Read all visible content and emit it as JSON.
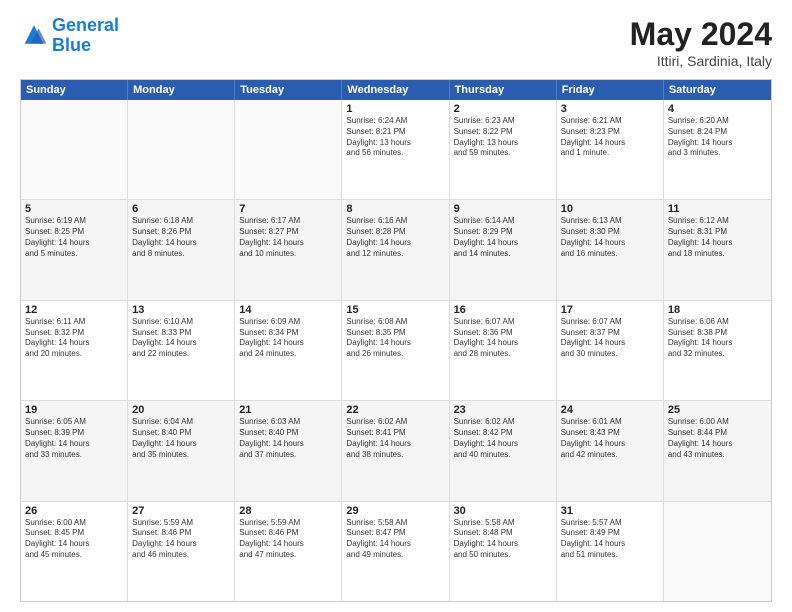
{
  "logo": {
    "text_general": "General",
    "text_blue": "Blue"
  },
  "header": {
    "title": "May 2024",
    "subtitle": "Ittiri, Sardinia, Italy"
  },
  "weekdays": [
    "Sunday",
    "Monday",
    "Tuesday",
    "Wednesday",
    "Thursday",
    "Friday",
    "Saturday"
  ],
  "rows": [
    [
      {
        "day": "",
        "empty": true,
        "lines": []
      },
      {
        "day": "",
        "empty": true,
        "lines": []
      },
      {
        "day": "",
        "empty": true,
        "lines": []
      },
      {
        "day": "1",
        "lines": [
          "Sunrise: 6:24 AM",
          "Sunset: 8:21 PM",
          "Daylight: 13 hours",
          "and 56 minutes."
        ]
      },
      {
        "day": "2",
        "lines": [
          "Sunrise: 6:23 AM",
          "Sunset: 8:22 PM",
          "Daylight: 13 hours",
          "and 59 minutes."
        ]
      },
      {
        "day": "3",
        "lines": [
          "Sunrise: 6:21 AM",
          "Sunset: 8:23 PM",
          "Daylight: 14 hours",
          "and 1 minute."
        ]
      },
      {
        "day": "4",
        "lines": [
          "Sunrise: 6:20 AM",
          "Sunset: 8:24 PM",
          "Daylight: 14 hours",
          "and 3 minutes."
        ]
      }
    ],
    [
      {
        "day": "5",
        "lines": [
          "Sunrise: 6:19 AM",
          "Sunset: 8:25 PM",
          "Daylight: 14 hours",
          "and 5 minutes."
        ]
      },
      {
        "day": "6",
        "lines": [
          "Sunrise: 6:18 AM",
          "Sunset: 8:26 PM",
          "Daylight: 14 hours",
          "and 8 minutes."
        ]
      },
      {
        "day": "7",
        "lines": [
          "Sunrise: 6:17 AM",
          "Sunset: 8:27 PM",
          "Daylight: 14 hours",
          "and 10 minutes."
        ]
      },
      {
        "day": "8",
        "lines": [
          "Sunrise: 6:16 AM",
          "Sunset: 8:28 PM",
          "Daylight: 14 hours",
          "and 12 minutes."
        ]
      },
      {
        "day": "9",
        "lines": [
          "Sunrise: 6:14 AM",
          "Sunset: 8:29 PM",
          "Daylight: 14 hours",
          "and 14 minutes."
        ]
      },
      {
        "day": "10",
        "lines": [
          "Sunrise: 6:13 AM",
          "Sunset: 8:30 PM",
          "Daylight: 14 hours",
          "and 16 minutes."
        ]
      },
      {
        "day": "11",
        "lines": [
          "Sunrise: 6:12 AM",
          "Sunset: 8:31 PM",
          "Daylight: 14 hours",
          "and 18 minutes."
        ]
      }
    ],
    [
      {
        "day": "12",
        "lines": [
          "Sunrise: 6:11 AM",
          "Sunset: 8:32 PM",
          "Daylight: 14 hours",
          "and 20 minutes."
        ]
      },
      {
        "day": "13",
        "lines": [
          "Sunrise: 6:10 AM",
          "Sunset: 8:33 PM",
          "Daylight: 14 hours",
          "and 22 minutes."
        ]
      },
      {
        "day": "14",
        "lines": [
          "Sunrise: 6:09 AM",
          "Sunset: 8:34 PM",
          "Daylight: 14 hours",
          "and 24 minutes."
        ]
      },
      {
        "day": "15",
        "lines": [
          "Sunrise: 6:08 AM",
          "Sunset: 8:35 PM",
          "Daylight: 14 hours",
          "and 26 minutes."
        ]
      },
      {
        "day": "16",
        "lines": [
          "Sunrise: 6:07 AM",
          "Sunset: 8:36 PM",
          "Daylight: 14 hours",
          "and 28 minutes."
        ]
      },
      {
        "day": "17",
        "lines": [
          "Sunrise: 6:07 AM",
          "Sunset: 8:37 PM",
          "Daylight: 14 hours",
          "and 30 minutes."
        ]
      },
      {
        "day": "18",
        "lines": [
          "Sunrise: 6:06 AM",
          "Sunset: 8:38 PM",
          "Daylight: 14 hours",
          "and 32 minutes."
        ]
      }
    ],
    [
      {
        "day": "19",
        "lines": [
          "Sunrise: 6:05 AM",
          "Sunset: 8:39 PM",
          "Daylight: 14 hours",
          "and 33 minutes."
        ]
      },
      {
        "day": "20",
        "lines": [
          "Sunrise: 6:04 AM",
          "Sunset: 8:40 PM",
          "Daylight: 14 hours",
          "and 35 minutes."
        ]
      },
      {
        "day": "21",
        "lines": [
          "Sunrise: 6:03 AM",
          "Sunset: 8:40 PM",
          "Daylight: 14 hours",
          "and 37 minutes."
        ]
      },
      {
        "day": "22",
        "lines": [
          "Sunrise: 6:02 AM",
          "Sunset: 8:41 PM",
          "Daylight: 14 hours",
          "and 38 minutes."
        ]
      },
      {
        "day": "23",
        "lines": [
          "Sunrise: 6:02 AM",
          "Sunset: 8:42 PM",
          "Daylight: 14 hours",
          "and 40 minutes."
        ]
      },
      {
        "day": "24",
        "lines": [
          "Sunrise: 6:01 AM",
          "Sunset: 8:43 PM",
          "Daylight: 14 hours",
          "and 42 minutes."
        ]
      },
      {
        "day": "25",
        "lines": [
          "Sunrise: 6:00 AM",
          "Sunset: 8:44 PM",
          "Daylight: 14 hours",
          "and 43 minutes."
        ]
      }
    ],
    [
      {
        "day": "26",
        "lines": [
          "Sunrise: 6:00 AM",
          "Sunset: 8:45 PM",
          "Daylight: 14 hours",
          "and 45 minutes."
        ]
      },
      {
        "day": "27",
        "lines": [
          "Sunrise: 5:59 AM",
          "Sunset: 8:46 PM",
          "Daylight: 14 hours",
          "and 46 minutes."
        ]
      },
      {
        "day": "28",
        "lines": [
          "Sunrise: 5:59 AM",
          "Sunset: 8:46 PM",
          "Daylight: 14 hours",
          "and 47 minutes."
        ]
      },
      {
        "day": "29",
        "lines": [
          "Sunrise: 5:58 AM",
          "Sunset: 8:47 PM",
          "Daylight: 14 hours",
          "and 49 minutes."
        ]
      },
      {
        "day": "30",
        "lines": [
          "Sunrise: 5:58 AM",
          "Sunset: 8:48 PM",
          "Daylight: 14 hours",
          "and 50 minutes."
        ]
      },
      {
        "day": "31",
        "lines": [
          "Sunrise: 5:57 AM",
          "Sunset: 8:49 PM",
          "Daylight: 14 hours",
          "and 51 minutes."
        ]
      },
      {
        "day": "",
        "empty": true,
        "lines": []
      }
    ]
  ]
}
